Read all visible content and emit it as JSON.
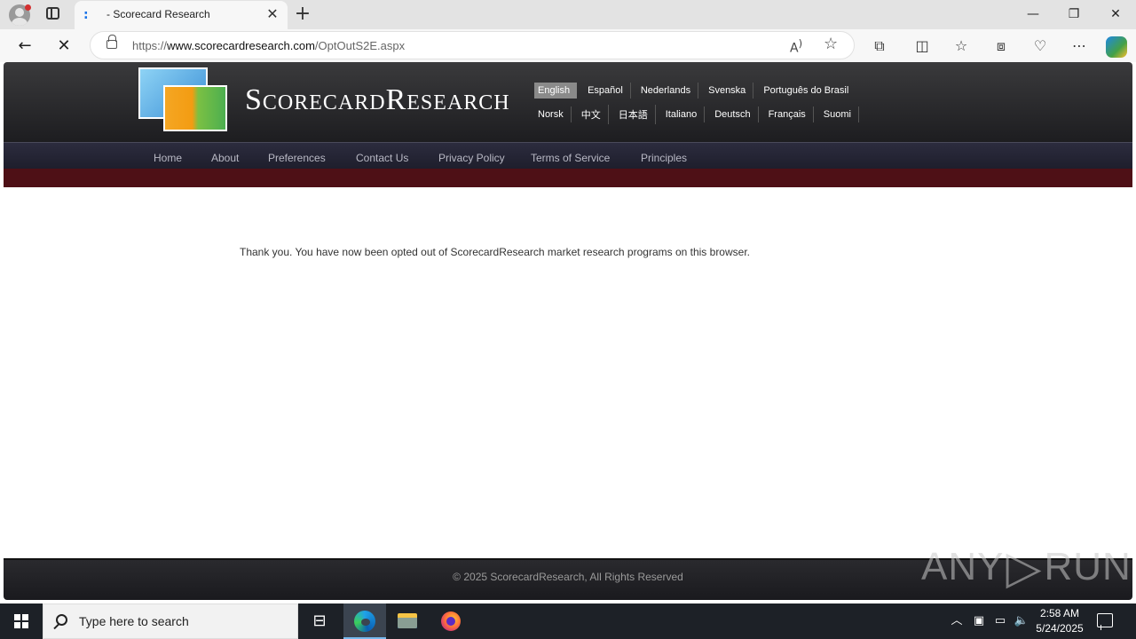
{
  "browser": {
    "tab_title": " - Scorecard Research",
    "tab_favicon": ":",
    "new_tab_glyph": "+",
    "url_prefix": "https://",
    "url_host": "www.scorecardresearch.com",
    "url_path": "/OptOutS2E.aspx",
    "window_controls": {
      "minimize": "—",
      "maximize": "❐",
      "close": "✕"
    }
  },
  "site": {
    "title": "ScorecardResearch",
    "languages_row1": [
      "English",
      "Español",
      "Nederlands",
      "Svenska",
      "Português do Brasil"
    ],
    "languages_row2": [
      "Norsk",
      "中文",
      "日本語",
      "Italiano",
      "Deutsch",
      "Français",
      "Suomi"
    ],
    "active_language": "English",
    "nav": [
      "Home",
      "About",
      "Preferences",
      "Contact Us",
      "Privacy Policy",
      "Terms of Service",
      "Principles"
    ],
    "message": "Thank you. You have now been opted out of ScorecardResearch market research programs on this browser.",
    "footer": "© 2025 ScorecardResearch, All Rights Reserved"
  },
  "watermark": {
    "left": "ANY",
    "right": "RUN"
  },
  "taskbar": {
    "search_placeholder": "Type here to search",
    "time": "2:58 AM",
    "date": "5/24/2025"
  },
  "colors": {
    "header_bg": "#2b2b2e",
    "nav_bg": "#25253a",
    "red_band": "#4e1016",
    "active_lang_bg": "#8a8a8a",
    "taskbar_bg": "#1d2127"
  }
}
